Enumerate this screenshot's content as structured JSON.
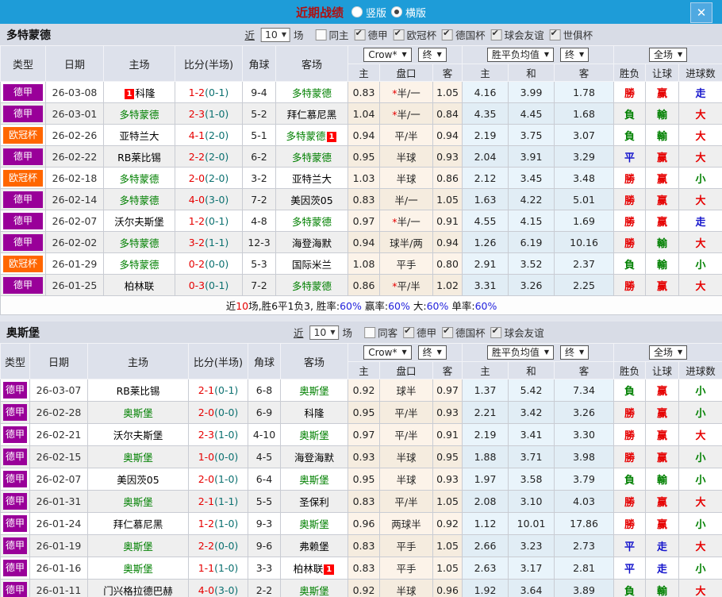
{
  "titlebar": {
    "title": "近期战绩",
    "radios": [
      {
        "label": "竖版",
        "checked": false
      },
      {
        "label": "横版",
        "checked": true
      }
    ],
    "close_glyph": "✕"
  },
  "header": {
    "cols": {
      "type": "类型",
      "date": "日期",
      "home": "主场",
      "score": "比分(半场)",
      "corner": "角球",
      "away": "客场",
      "h": "主",
      "pan": "盘口",
      "a": "客",
      "avg_h": "主",
      "avg_d": "和",
      "avg_a": "客",
      "wl": "胜负",
      "rang": "让球",
      "goals": "进球数"
    },
    "selects": {
      "company": "Crow*",
      "final1": "终",
      "avg": "胜平负均值",
      "final2": "终",
      "scope": "全场"
    }
  },
  "league_colors": {
    "德甲": "#990099",
    "欧冠杯": "#ff6600"
  },
  "accent_color": "#1e9cd8",
  "tables": [
    {
      "team": "多特蒙德",
      "filter": {
        "near": "近",
        "count": "10",
        "unit": "场",
        "checkboxes": [
          {
            "label": "同主",
            "checked": false
          },
          {
            "label": "德甲",
            "checked": true
          },
          {
            "label": "欧冠杯",
            "checked": true
          },
          {
            "label": "德国杯",
            "checked": true
          },
          {
            "label": "球会友谊",
            "checked": true
          },
          {
            "label": "世俱杯",
            "checked": true
          }
        ]
      },
      "rows": [
        {
          "league": "德甲",
          "date": "26-03-08",
          "home": {
            "name": "科隆",
            "green": false,
            "card_before": "1"
          },
          "score": "1-2",
          "half": "(0-1)",
          "corner": "9-4",
          "away": {
            "name": "多特蒙德",
            "green": true
          },
          "odds": [
            "0.83",
            "*半/一",
            "1.05"
          ],
          "avg": [
            "4.16",
            "3.99",
            "1.78"
          ],
          "results": [
            "勝",
            "赢",
            "走"
          ]
        },
        {
          "league": "德甲",
          "date": "26-03-01",
          "home": {
            "name": "多特蒙德",
            "green": true
          },
          "score": "2-3",
          "half": "(1-0)",
          "corner": "5-2",
          "away": {
            "name": "拜仁慕尼黑",
            "green": false
          },
          "odds": [
            "1.04",
            "*半/一",
            "0.84"
          ],
          "avg": [
            "4.35",
            "4.45",
            "1.68"
          ],
          "results": [
            "負",
            "輸",
            "大"
          ]
        },
        {
          "league": "欧冠杯",
          "date": "26-02-26",
          "home": {
            "name": "亚特兰大",
            "green": false
          },
          "score": "4-1",
          "half": "(2-0)",
          "corner": "5-1",
          "away": {
            "name": "多特蒙德",
            "green": true,
            "card_after": "1"
          },
          "odds": [
            "0.94",
            "平/半",
            "0.94"
          ],
          "avg": [
            "2.19",
            "3.75",
            "3.07"
          ],
          "results": [
            "負",
            "輸",
            "大"
          ]
        },
        {
          "league": "德甲",
          "date": "26-02-22",
          "home": {
            "name": "RB莱比锡",
            "green": false
          },
          "score": "2-2",
          "half": "(2-0)",
          "corner": "6-2",
          "away": {
            "name": "多特蒙德",
            "green": true
          },
          "odds": [
            "0.95",
            "半球",
            "0.93"
          ],
          "avg": [
            "2.04",
            "3.91",
            "3.29"
          ],
          "results": [
            "平",
            "赢",
            "大"
          ]
        },
        {
          "league": "欧冠杯",
          "date": "26-02-18",
          "home": {
            "name": "多特蒙德",
            "green": true
          },
          "score": "2-0",
          "half": "(2-0)",
          "corner": "3-2",
          "away": {
            "name": "亚特兰大",
            "green": false
          },
          "odds": [
            "1.03",
            "半球",
            "0.86"
          ],
          "avg": [
            "2.12",
            "3.45",
            "3.48"
          ],
          "results": [
            "勝",
            "赢",
            "小"
          ]
        },
        {
          "league": "德甲",
          "date": "26-02-14",
          "home": {
            "name": "多特蒙德",
            "green": true
          },
          "score": "4-0",
          "half": "(3-0)",
          "corner": "7-2",
          "away": {
            "name": "美因茨05",
            "green": false
          },
          "odds": [
            "0.83",
            "半/一",
            "1.05"
          ],
          "avg": [
            "1.63",
            "4.22",
            "5.01"
          ],
          "results": [
            "勝",
            "赢",
            "大"
          ]
        },
        {
          "league": "德甲",
          "date": "26-02-07",
          "home": {
            "name": "沃尔夫斯堡",
            "green": false
          },
          "score": "1-2",
          "half": "(0-1)",
          "corner": "4-8",
          "away": {
            "name": "多特蒙德",
            "green": true
          },
          "odds": [
            "0.97",
            "*半/一",
            "0.91"
          ],
          "avg": [
            "4.55",
            "4.15",
            "1.69"
          ],
          "results": [
            "勝",
            "赢",
            "走"
          ]
        },
        {
          "league": "德甲",
          "date": "26-02-02",
          "home": {
            "name": "多特蒙德",
            "green": true
          },
          "score": "3-2",
          "half": "(1-1)",
          "corner": "12-3",
          "away": {
            "name": "海登海默",
            "green": false
          },
          "odds": [
            "0.94",
            "球半/两",
            "0.94"
          ],
          "avg": [
            "1.26",
            "6.19",
            "10.16"
          ],
          "results": [
            "勝",
            "輸",
            "大"
          ]
        },
        {
          "league": "欧冠杯",
          "date": "26-01-29",
          "home": {
            "name": "多特蒙德",
            "green": true
          },
          "score": "0-2",
          "half": "(0-0)",
          "corner": "5-3",
          "away": {
            "name": "国际米兰",
            "green": false
          },
          "odds": [
            "1.08",
            "平手",
            "0.80"
          ],
          "avg": [
            "2.91",
            "3.52",
            "2.37"
          ],
          "results": [
            "負",
            "輸",
            "小"
          ]
        },
        {
          "league": "德甲",
          "date": "26-01-25",
          "home": {
            "name": "柏林联",
            "green": false
          },
          "score": "0-3",
          "half": "(0-1)",
          "corner": "7-2",
          "away": {
            "name": "多特蒙德",
            "green": true
          },
          "odds": [
            "0.86",
            "*平/半",
            "1.02"
          ],
          "avg": [
            "3.31",
            "3.26",
            "2.25"
          ],
          "results": [
            "勝",
            "赢",
            "大"
          ]
        }
      ],
      "summary": {
        "p0": "近",
        "p1": "10",
        "p2": "场,胜6平1负3, 胜率:",
        "p3": "60%",
        "p4": " 赢率:",
        "p5": "60%",
        "p6": " 大:",
        "p7": "60%",
        "p8": " 单率:",
        "p9": "60%"
      }
    },
    {
      "team": "奥斯堡",
      "filter": {
        "near": "近",
        "count": "10",
        "unit": "场",
        "checkboxes": [
          {
            "label": "同客",
            "checked": false
          },
          {
            "label": "德甲",
            "checked": true
          },
          {
            "label": "德国杯",
            "checked": true
          },
          {
            "label": "球会友谊",
            "checked": true
          }
        ]
      },
      "rows": [
        {
          "league": "德甲",
          "date": "26-03-07",
          "home": {
            "name": "RB莱比锡",
            "green": false
          },
          "score": "2-1",
          "half": "(0-1)",
          "corner": "6-8",
          "away": {
            "name": "奥斯堡",
            "green": true
          },
          "odds": [
            "0.92",
            "球半",
            "0.97"
          ],
          "avg": [
            "1.37",
            "5.42",
            "7.34"
          ],
          "results": [
            "負",
            "赢",
            "小"
          ]
        },
        {
          "league": "德甲",
          "date": "26-02-28",
          "home": {
            "name": "奥斯堡",
            "green": true
          },
          "score": "2-0",
          "half": "(0-0)",
          "corner": "6-9",
          "away": {
            "name": "科隆",
            "green": false
          },
          "odds": [
            "0.95",
            "平/半",
            "0.93"
          ],
          "avg": [
            "2.21",
            "3.42",
            "3.26"
          ],
          "results": [
            "勝",
            "赢",
            "小"
          ]
        },
        {
          "league": "德甲",
          "date": "26-02-21",
          "home": {
            "name": "沃尔夫斯堡",
            "green": false
          },
          "score": "2-3",
          "half": "(1-0)",
          "corner": "4-10",
          "away": {
            "name": "奥斯堡",
            "green": true
          },
          "odds": [
            "0.97",
            "平/半",
            "0.91"
          ],
          "avg": [
            "2.19",
            "3.41",
            "3.30"
          ],
          "results": [
            "勝",
            "赢",
            "大"
          ]
        },
        {
          "league": "德甲",
          "date": "26-02-15",
          "home": {
            "name": "奥斯堡",
            "green": true
          },
          "score": "1-0",
          "half": "(0-0)",
          "corner": "4-5",
          "away": {
            "name": "海登海默",
            "green": false
          },
          "odds": [
            "0.93",
            "半球",
            "0.95"
          ],
          "avg": [
            "1.88",
            "3.71",
            "3.98"
          ],
          "results": [
            "勝",
            "赢",
            "小"
          ]
        },
        {
          "league": "德甲",
          "date": "26-02-07",
          "home": {
            "name": "美因茨05",
            "green": false
          },
          "score": "2-0",
          "half": "(1-0)",
          "corner": "6-4",
          "away": {
            "name": "奥斯堡",
            "green": true
          },
          "odds": [
            "0.95",
            "半球",
            "0.93"
          ],
          "avg": [
            "1.97",
            "3.58",
            "3.79"
          ],
          "results": [
            "負",
            "輸",
            "小"
          ]
        },
        {
          "league": "德甲",
          "date": "26-01-31",
          "home": {
            "name": "奥斯堡",
            "green": true
          },
          "score": "2-1",
          "half": "(1-1)",
          "corner": "5-5",
          "away": {
            "name": "圣保利",
            "green": false
          },
          "odds": [
            "0.83",
            "平/半",
            "1.05"
          ],
          "avg": [
            "2.08",
            "3.10",
            "4.03"
          ],
          "results": [
            "勝",
            "赢",
            "大"
          ]
        },
        {
          "league": "德甲",
          "date": "26-01-24",
          "home": {
            "name": "拜仁慕尼黑",
            "green": false
          },
          "score": "1-2",
          "half": "(1-0)",
          "corner": "9-3",
          "away": {
            "name": "奥斯堡",
            "green": true
          },
          "odds": [
            "0.96",
            "两球半",
            "0.92"
          ],
          "avg": [
            "1.12",
            "10.01",
            "17.86"
          ],
          "results": [
            "勝",
            "赢",
            "小"
          ]
        },
        {
          "league": "德甲",
          "date": "26-01-19",
          "home": {
            "name": "奥斯堡",
            "green": true
          },
          "score": "2-2",
          "half": "(0-0)",
          "corner": "9-6",
          "away": {
            "name": "弗赖堡",
            "green": false
          },
          "odds": [
            "0.83",
            "平手",
            "1.05"
          ],
          "avg": [
            "2.66",
            "3.23",
            "2.73"
          ],
          "results": [
            "平",
            "走",
            "大"
          ]
        },
        {
          "league": "德甲",
          "date": "26-01-16",
          "home": {
            "name": "奥斯堡",
            "green": true
          },
          "score": "1-1",
          "half": "(1-0)",
          "corner": "3-3",
          "away": {
            "name": "柏林联",
            "green": false,
            "card_after": "1"
          },
          "odds": [
            "0.83",
            "平手",
            "1.05"
          ],
          "avg": [
            "2.63",
            "3.17",
            "2.81"
          ],
          "results": [
            "平",
            "走",
            "小"
          ]
        },
        {
          "league": "德甲",
          "date": "26-01-11",
          "home": {
            "name": "门兴格拉德巴赫",
            "green": false
          },
          "score": "4-0",
          "half": "(3-0)",
          "corner": "2-2",
          "away": {
            "name": "奥斯堡",
            "green": true
          },
          "odds": [
            "0.92",
            "半球",
            "0.96"
          ],
          "avg": [
            "1.92",
            "3.64",
            "3.89"
          ],
          "results": [
            "負",
            "輸",
            "大"
          ]
        }
      ]
    }
  ]
}
